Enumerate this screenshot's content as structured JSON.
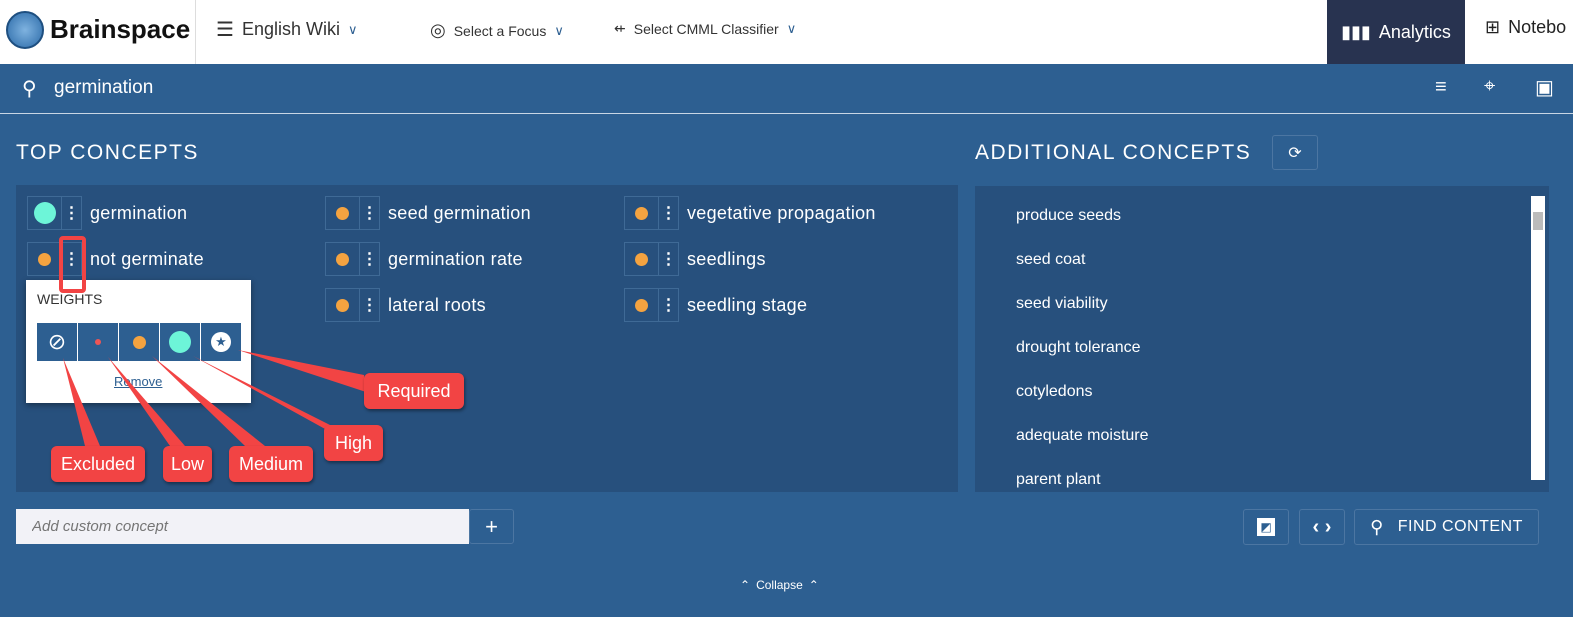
{
  "header": {
    "brand": "Brainspace",
    "dataset": "English Wiki",
    "focus": "Select a Focus",
    "classifier": "Select CMML Classifier",
    "analytics": "Analytics",
    "notebook": "Notebo"
  },
  "search": {
    "query": "germination"
  },
  "top_concepts": {
    "title": "TOP CONCEPTS",
    "items": [
      {
        "label": "germination",
        "weight": "high"
      },
      {
        "label": "not germinate",
        "weight": "medium"
      },
      {
        "label": "seed germination",
        "weight": "medium"
      },
      {
        "label": "germination rate",
        "weight": "medium"
      },
      {
        "label": "lateral roots",
        "weight": "medium"
      },
      {
        "label": "vegetative propagation",
        "weight": "medium"
      },
      {
        "label": "seedlings",
        "weight": "medium"
      },
      {
        "label": "seedling stage",
        "weight": "medium"
      }
    ]
  },
  "weights_popup": {
    "title": "WEIGHTS",
    "remove": "Remove",
    "options": [
      "excluded",
      "low",
      "medium",
      "high",
      "required"
    ]
  },
  "callouts": {
    "excluded": "Excluded",
    "low": "Low",
    "medium": "Medium",
    "high": "High",
    "required": "Required"
  },
  "additional_concepts": {
    "title": "ADDITIONAL CONCEPTS",
    "items": [
      "produce seeds",
      "seed coat",
      "seed viability",
      "drought tolerance",
      "cotyledons",
      "adequate moisture",
      "parent plant"
    ]
  },
  "custom": {
    "placeholder": "Add custom concept",
    "add": "+"
  },
  "actions": {
    "find": "FIND CONTENT",
    "code": "‹ ›"
  },
  "footer": {
    "collapse": "Collapse"
  },
  "colors": {
    "medium": "#f4a340",
    "high": "#6df5d8",
    "low": "#ee5555",
    "callout": "#f24444",
    "panel": "#27507d",
    "bg": "#2d5f91"
  }
}
